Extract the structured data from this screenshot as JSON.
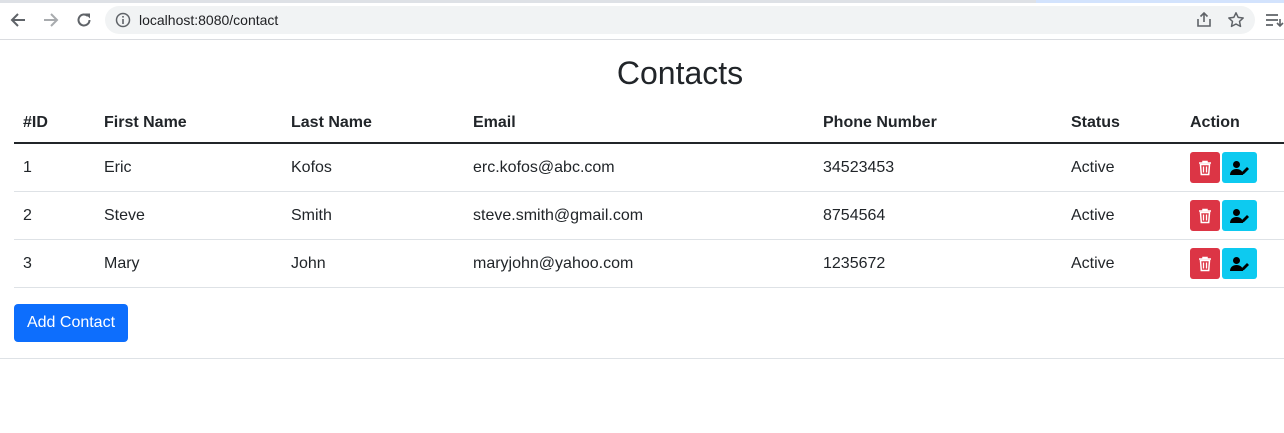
{
  "browser": {
    "url": "localhost:8080/contact"
  },
  "page": {
    "title": "Contacts",
    "add_button_label": "Add Contact"
  },
  "table": {
    "headers": [
      "#ID",
      "First Name",
      "Last Name",
      "Email",
      "Phone Number",
      "Status",
      "Action"
    ],
    "rows": [
      {
        "id": "1",
        "first_name": "Eric",
        "last_name": "Kofos",
        "email": "erc.kofos@abc.com",
        "phone": "34523453",
        "status": "Active"
      },
      {
        "id": "2",
        "first_name": "Steve",
        "last_name": "Smith",
        "email": "steve.smith@gmail.com",
        "phone": "8754564",
        "status": "Active"
      },
      {
        "id": "3",
        "first_name": "Mary",
        "last_name": "John",
        "email": "maryjohn@yahoo.com",
        "phone": "1235672",
        "status": "Active"
      }
    ],
    "actions": [
      {
        "icon": "trash-icon",
        "color": "#dc3545"
      },
      {
        "icon": "user-edit-icon",
        "color": "#0dcaf0"
      }
    ]
  },
  "colors": {
    "primary": "#0d6efd",
    "danger": "#dc3545",
    "info": "#0dcaf0"
  }
}
